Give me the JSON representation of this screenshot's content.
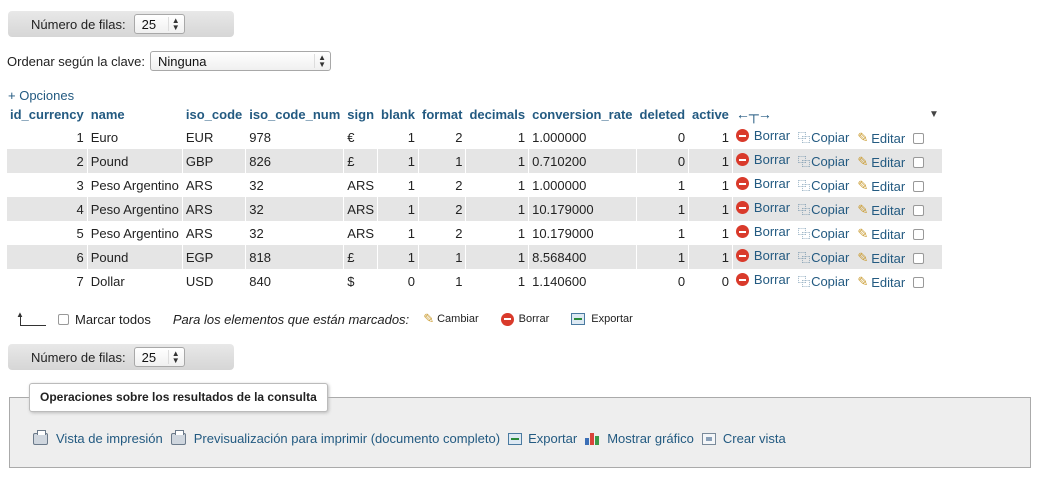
{
  "nav": {
    "rows_label": "Número de filas:",
    "rows_value": "25"
  },
  "sort": {
    "label": "Ordenar según la clave:",
    "value": "Ninguna"
  },
  "options_link": "+ Opciones",
  "columns": [
    "id_currency",
    "name",
    "iso_code",
    "iso_code_num",
    "sign",
    "blank",
    "format",
    "decimals",
    "conversion_rate",
    "deleted",
    "active"
  ],
  "column_nav_icons": "←┬→",
  "rows": [
    {
      "id_currency": "1",
      "name": "Euro",
      "iso_code": "EUR",
      "iso_code_num": "978",
      "sign": "€",
      "blank": "1",
      "format": "2",
      "decimals": "1",
      "conversion_rate": "1.000000",
      "deleted": "0",
      "active": "1"
    },
    {
      "id_currency": "2",
      "name": "Pound",
      "iso_code": "GBP",
      "iso_code_num": "826",
      "sign": "£",
      "blank": "1",
      "format": "1",
      "decimals": "1",
      "conversion_rate": "0.710200",
      "deleted": "0",
      "active": "1"
    },
    {
      "id_currency": "3",
      "name": "Peso Argentino",
      "iso_code": "ARS",
      "iso_code_num": "32",
      "sign": "ARS",
      "blank": "1",
      "format": "2",
      "decimals": "1",
      "conversion_rate": "1.000000",
      "deleted": "1",
      "active": "1"
    },
    {
      "id_currency": "4",
      "name": "Peso Argentino",
      "iso_code": "ARS",
      "iso_code_num": "32",
      "sign": "ARS",
      "blank": "1",
      "format": "2",
      "decimals": "1",
      "conversion_rate": "10.179000",
      "deleted": "1",
      "active": "1"
    },
    {
      "id_currency": "5",
      "name": "Peso Argentino",
      "iso_code": "ARS",
      "iso_code_num": "32",
      "sign": "ARS",
      "blank": "1",
      "format": "2",
      "decimals": "1",
      "conversion_rate": "10.179000",
      "deleted": "1",
      "active": "1"
    },
    {
      "id_currency": "6",
      "name": "Pound",
      "iso_code": "EGP",
      "iso_code_num": "818",
      "sign": "£",
      "blank": "1",
      "format": "1",
      "decimals": "1",
      "conversion_rate": "8.568400",
      "deleted": "1",
      "active": "1"
    },
    {
      "id_currency": "7",
      "name": "Dollar",
      "iso_code": "USD",
      "iso_code_num": "840",
      "sign": "$",
      "blank": "0",
      "format": "1",
      "decimals": "1",
      "conversion_rate": "1.140600",
      "deleted": "0",
      "active": "0"
    }
  ],
  "row_actions": {
    "delete": "Borrar",
    "copy": "Copiar",
    "edit": "Editar"
  },
  "bulk": {
    "check_all": "Marcar todos",
    "with_selected": "Para los elementos que están marcados:",
    "change": "Cambiar",
    "delete": "Borrar",
    "export": "Exportar"
  },
  "operations": {
    "legend": "Operaciones sobre los resultados de la consulta",
    "print_view": "Vista de impresión",
    "print_full": "Previsualización para imprimir (documento completo)",
    "export": "Exportar",
    "chart": "Mostrar gráfico",
    "create_view": "Crear vista"
  },
  "colors": {
    "link": "#235a81",
    "row_even": "#e5e5e5",
    "delete_icon": "#d93a2b",
    "panel_bg": "#eeeeee"
  }
}
